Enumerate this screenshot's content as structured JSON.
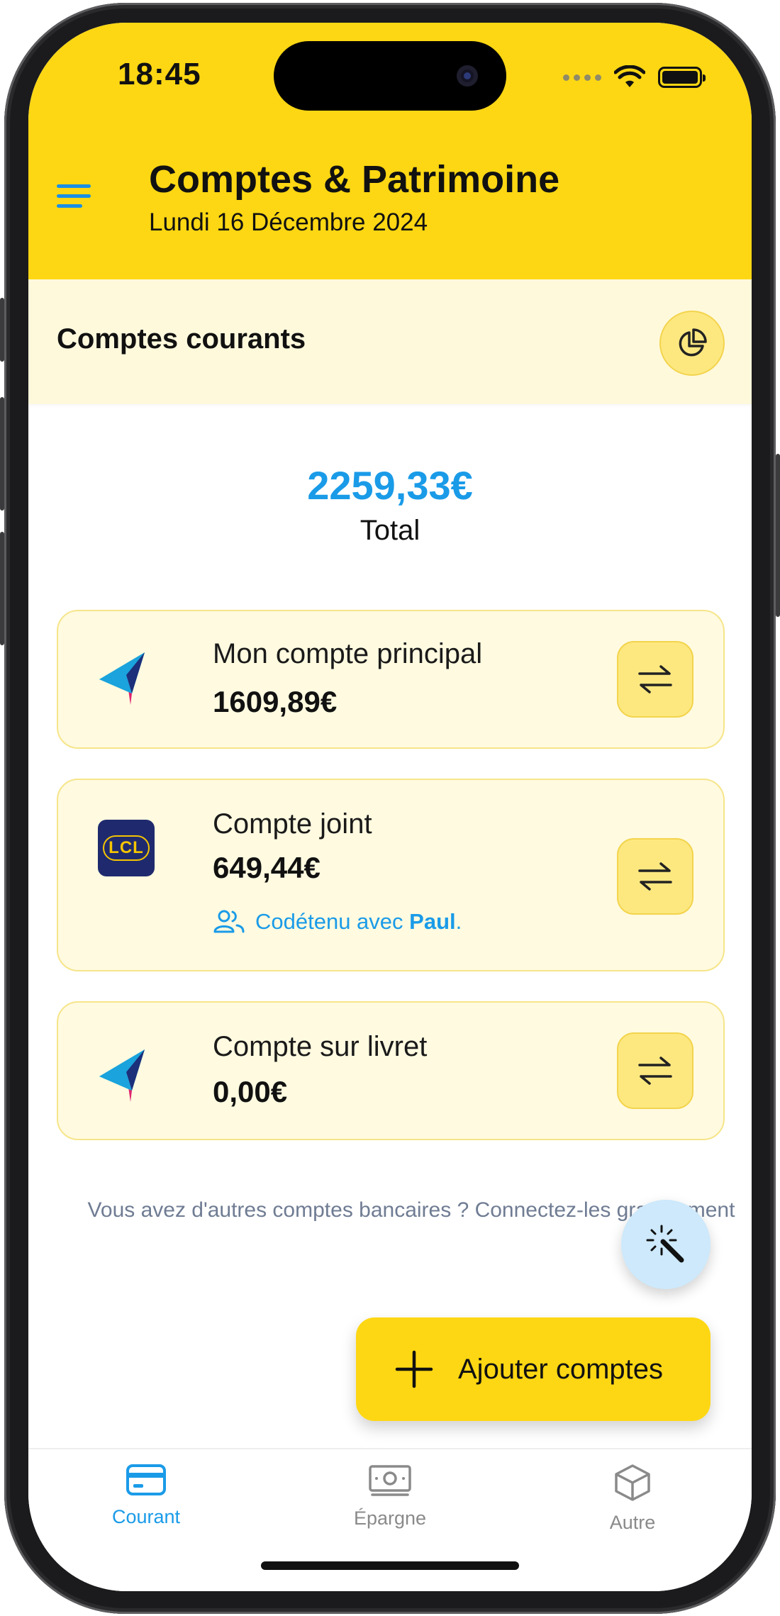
{
  "status_bar": {
    "time": "18:45"
  },
  "header": {
    "title": "Comptes & Patrimoine",
    "date": "Lundi 16 Décembre 2024"
  },
  "section": {
    "title": "Comptes courants"
  },
  "summary": {
    "total_amount": "2259,33€",
    "total_label": "Total"
  },
  "accounts": [
    {
      "name": "Mon compte principal",
      "balance": "1609,89€",
      "logo": "arrow-bank-logo"
    },
    {
      "name": "Compte joint",
      "balance": "649,44€",
      "logo": "lcl-bank-logo",
      "shared_prefix": "Codétenu avec ",
      "shared_with": "Paul",
      "shared_suffix": "."
    },
    {
      "name": "Compte sur livret",
      "balance": "0,00€",
      "logo": "arrow-bank-logo"
    }
  ],
  "connect_text": "Vous avez d'autres comptes bancaires ? Connectez-les gratuitement",
  "add_button": {
    "label": "Ajouter comptes"
  },
  "tabs": [
    {
      "label": "Courant",
      "icon": "card-icon",
      "active": true
    },
    {
      "label": "Épargne",
      "icon": "banknote-icon",
      "active": false
    },
    {
      "label": "Autre",
      "icon": "cube-icon",
      "active": false
    }
  ],
  "colors": {
    "brand_yellow": "#fdd713",
    "accent_blue": "#1a9be8",
    "card_bg": "#fffae0",
    "inactive_tab": "#8a8a8a"
  }
}
